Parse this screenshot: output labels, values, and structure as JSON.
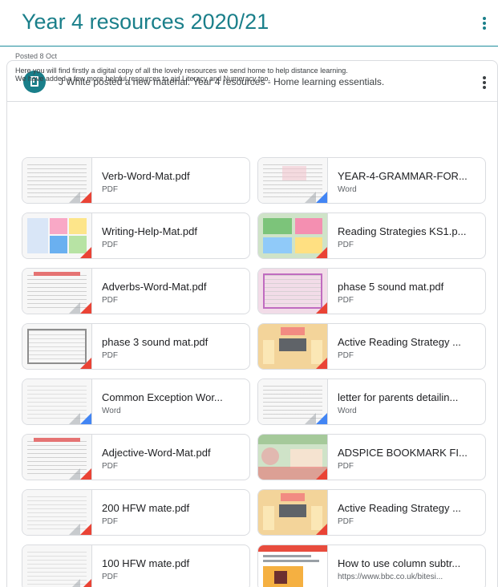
{
  "header": {
    "title": "Year 4 resources 2020/21"
  },
  "post": {
    "author_line": "J White posted a new material: Year 4 resources - Home learning essentials.",
    "date": "Posted 8 Oct",
    "description_1": "Here you will find firstly a digital copy of all the lovely resources we send home to help distance learning.",
    "description_2": "We have added a few more helpful resources to aid Literacy and Numeracy too."
  },
  "attachments": [
    {
      "name": "Verb-Word-Mat.pdf",
      "type": "PDF",
      "icon": "pdf-file-icon"
    },
    {
      "name": "YEAR-4-GRAMMAR-FOR...",
      "type": "Word",
      "icon": "word-file-icon"
    },
    {
      "name": "Writing-Help-Mat.pdf",
      "type": "PDF",
      "icon": "pdf-file-icon"
    },
    {
      "name": "Reading Strategies KS1.p...",
      "type": "PDF",
      "icon": "pdf-file-icon"
    },
    {
      "name": "Adverbs-Word-Mat.pdf",
      "type": "PDF",
      "icon": "pdf-file-icon"
    },
    {
      "name": "phase 5 sound mat.pdf",
      "type": "PDF",
      "icon": "pdf-file-icon"
    },
    {
      "name": "phase 3 sound mat.pdf",
      "type": "PDF",
      "icon": "pdf-file-icon"
    },
    {
      "name": "Active Reading Strategy ...",
      "type": "PDF",
      "icon": "pdf-file-icon"
    },
    {
      "name": "Common Exception Wor...",
      "type": "Word",
      "icon": "word-file-icon"
    },
    {
      "name": "letter for parents detailin...",
      "type": "Word",
      "icon": "word-file-icon"
    },
    {
      "name": "Adjective-Word-Mat.pdf",
      "type": "PDF",
      "icon": "pdf-file-icon"
    },
    {
      "name": "ADSPICE BOOKMARK FI...",
      "type": "PDF",
      "icon": "pdf-file-icon"
    },
    {
      "name": "200 HFW mate.pdf",
      "type": "PDF",
      "icon": "pdf-file-icon"
    },
    {
      "name": "Active Reading Strategy ...",
      "type": "PDF",
      "icon": "pdf-file-icon"
    },
    {
      "name": "100 HFW mate.pdf",
      "type": "PDF",
      "icon": "pdf-file-icon"
    },
    {
      "name": "How to use column subtr...",
      "type": "https://www.bbc.co.uk/bitesi...",
      "icon": "link-icon"
    }
  ],
  "colors": {
    "accent": "#1a7f8a",
    "pdf": "#ea4335",
    "word": "#4285f4"
  }
}
